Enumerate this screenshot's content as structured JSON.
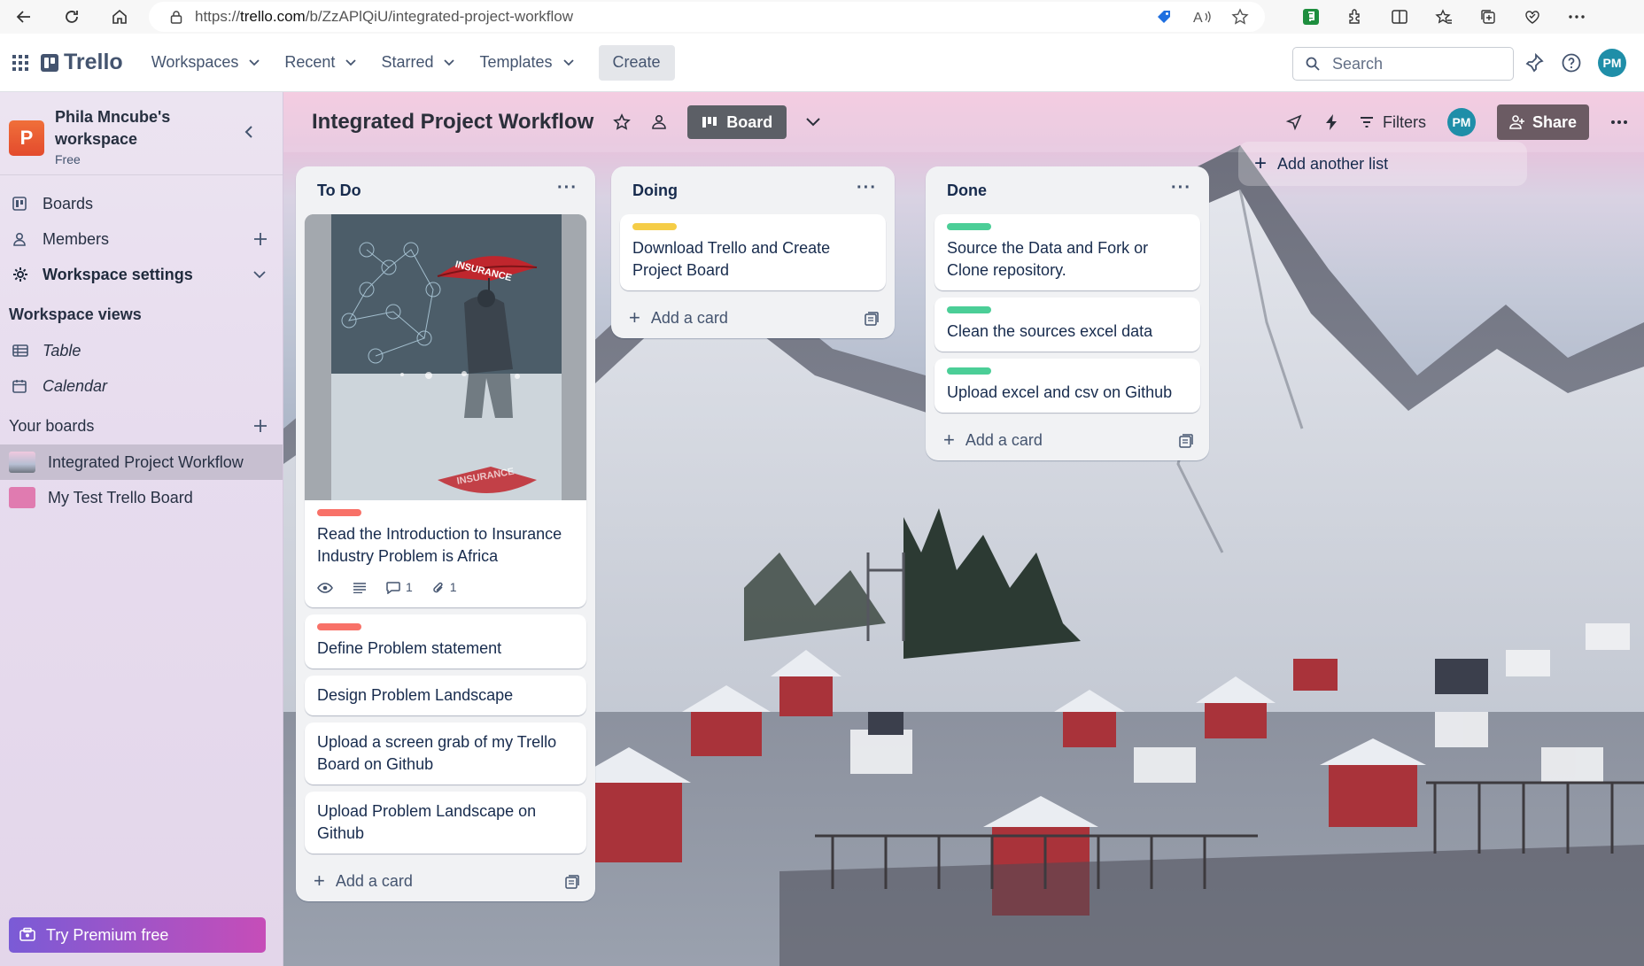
{
  "browser": {
    "url_prefix": "https://",
    "url_domain": "trello.com",
    "url_path": "/b/ZzAPlQiU/integrated-project-workflow"
  },
  "header": {
    "brand": "Trello",
    "nav": [
      "Workspaces",
      "Recent",
      "Starred",
      "Templates"
    ],
    "create_label": "Create",
    "search_placeholder": "Search",
    "avatar_initials": "PM"
  },
  "sidebar": {
    "workspace_initial": "P",
    "workspace_name_line1": "Phila Mncube's",
    "workspace_name_line2": "workspace",
    "workspace_plan": "Free",
    "items": [
      {
        "label": "Boards"
      },
      {
        "label": "Members"
      },
      {
        "label": "Workspace settings"
      }
    ],
    "views_title": "Workspace views",
    "views": [
      {
        "label": "Table"
      },
      {
        "label": "Calendar"
      }
    ],
    "boards_title": "Your boards",
    "boards": [
      {
        "label": "Integrated Project Workflow",
        "color": "#b7bfd3"
      },
      {
        "label": "My Test Trello Board",
        "color": "#e07bb0"
      }
    ],
    "premium_label": "Try Premium free"
  },
  "board": {
    "title": "Integrated Project Workflow",
    "view_label": "Board",
    "filters_label": "Filters",
    "share_label": "Share",
    "avatar_initials": "PM",
    "add_list_label": "Add another list",
    "add_card_label": "Add a card",
    "cover_text": "INSURANCE",
    "lists": [
      {
        "title": "To Do",
        "cards": [
          {
            "title": "Read the Introduction to Insurance Industry Problem is Africa",
            "label_color": "#f87168",
            "comments": "1",
            "attachments": "1"
          },
          {
            "title": "Define Problem statement",
            "label_color": "#f87168"
          },
          {
            "title": "Design Problem Landscape"
          },
          {
            "title": "Upload a screen grab of my Trello Board on Github"
          },
          {
            "title": "Upload Problem Landscape on Github"
          }
        ]
      },
      {
        "title": "Doing",
        "cards": [
          {
            "title": "Download Trello and Create Project Board",
            "label_color": "#f5cd47"
          }
        ]
      },
      {
        "title": "Done",
        "cards": [
          {
            "title": "Source the Data and Fork or Clone repository.",
            "label_color": "#4bce97"
          },
          {
            "title": "Clean the sources excel data",
            "label_color": "#4bce97"
          },
          {
            "title": "Upload excel and csv on Github",
            "label_color": "#4bce97"
          }
        ]
      }
    ]
  }
}
